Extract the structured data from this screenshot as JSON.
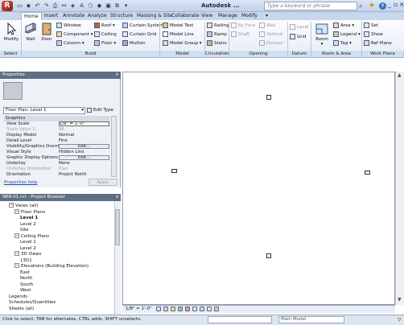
{
  "title_bar": {
    "logo_letter": "R",
    "app_title": "Autodesk ...",
    "search_placeholder": "Type a keyword or phrase",
    "icons": [
      "open-icon",
      "save-icon",
      "undo-icon",
      "redo-icon",
      "print-icon",
      "measure-icon",
      "tag-icon",
      "text-icon",
      "3d-view-icon",
      "section-icon",
      "search-icon",
      "favorites-star-icon",
      "help-icon"
    ]
  },
  "ribbon_tabs": [
    "Home",
    "Insert",
    "Annotate",
    "Analyze",
    "Structure",
    "Massing & Site",
    "Collaborate",
    "View",
    "Manage",
    "Modify"
  ],
  "active_tab": "Home",
  "ribbon": {
    "modify": "Modify",
    "wall": "Wall",
    "door": "Door",
    "window": "Window",
    "component": "Component",
    "column": "Column",
    "roof": "Roof",
    "ceiling": "Ceiling",
    "floor": "Floor",
    "curtain_system": "Curtain System",
    "curtain_grid": "Curtain Grid",
    "mullion": "Mullion",
    "model_text": "Model Text",
    "model_line": "Model Line",
    "model_group": "Model Group",
    "railing": "Railing",
    "ramp": "Ramp",
    "stairs": "Stairs",
    "by_face": "By Face",
    "shaft": "Shaft",
    "wall_opening": "Wall",
    "vertical": "Vertical",
    "dormer": "Dormer",
    "level": "Level",
    "grid": "Grid",
    "room": "Room",
    "area": "Area",
    "legend": "Legend",
    "tag": "Tag",
    "set": "Set",
    "show": "Show",
    "ref_plane": "Ref Plane"
  },
  "panels": {
    "select": "Select",
    "build": "Build",
    "model": "Model",
    "circulation": "Circulation",
    "opening": "Opening",
    "datum": "Datum",
    "room_area": "Room & Area",
    "work_plane": "Work Plane"
  },
  "properties": {
    "title": "Properties",
    "close": "×",
    "view_selector": "Floor Plan: Level 1",
    "edit_type": "Edit Type",
    "group": "Graphics",
    "rows": [
      {
        "key": "View Scale",
        "value": "1/8\" = 1'-0\""
      },
      {
        "key": "Scale Value    1:",
        "value": "96"
      },
      {
        "key": "Display Model",
        "value": "Normal"
      },
      {
        "key": "Detail Level",
        "value": "Fine"
      },
      {
        "key": "Visibility/Graphics Overri...",
        "value": "Edit..."
      },
      {
        "key": "Visual Style",
        "value": "Hidden Line"
      },
      {
        "key": "Graphic Display Options",
        "value": "Edit..."
      },
      {
        "key": "Underlay",
        "value": "None"
      },
      {
        "key": "Underlay Orientation",
        "value": "Plan"
      },
      {
        "key": "Orientation",
        "value": "Project North"
      }
    ],
    "help_link": "Properties help",
    "apply": "Apply"
  },
  "project_browser": {
    "title": "NER-01.rvt - Project Browser",
    "close": "×",
    "items": [
      {
        "label": "Views (all)",
        "toggle": "−",
        "bold": false
      },
      {
        "label": "Floor Plans",
        "toggle": "−",
        "bold": false
      },
      {
        "label": "Level 1",
        "toggle": "",
        "bold": true
      },
      {
        "label": "Level 2",
        "toggle": "",
        "bold": false
      },
      {
        "label": "Site",
        "toggle": "",
        "bold": false
      },
      {
        "label": "Ceiling Plans",
        "toggle": "−",
        "bold": false
      },
      {
        "label": "Level 1",
        "toggle": "",
        "bold": false
      },
      {
        "label": "Level 2",
        "toggle": "",
        "bold": false
      },
      {
        "label": "3D Views",
        "toggle": "−",
        "bold": false
      },
      {
        "label": "{3D}",
        "toggle": "",
        "bold": false
      },
      {
        "label": "Elevations (Building Elevation)",
        "toggle": "−",
        "bold": false
      },
      {
        "label": "East",
        "toggle": "",
        "bold": false
      },
      {
        "label": "North",
        "toggle": "",
        "bold": false
      },
      {
        "label": "South",
        "toggle": "",
        "bold": false
      },
      {
        "label": "West",
        "toggle": "",
        "bold": false
      },
      {
        "label": "Legends",
        "toggle": "",
        "bold": false
      },
      {
        "label": "Schedules/Quantities",
        "toggle": "",
        "bold": false
      },
      {
        "label": "Sheets (all)",
        "toggle": "",
        "bold": false
      }
    ]
  },
  "view_bar": {
    "scale": "1/8\" = 1'-0\""
  },
  "status_bar": {
    "text": "Click to select, TAB for alternates, CTRL adds, SHIFT unselects.",
    "model": "Main Model",
    "filter": "▽"
  }
}
